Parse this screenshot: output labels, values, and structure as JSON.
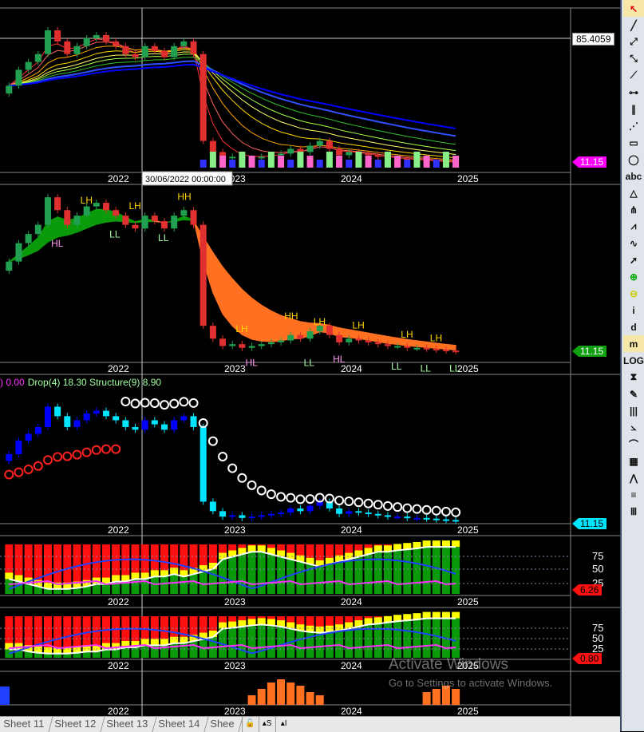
{
  "chart_data": {
    "type": "candlestick",
    "x_ticks": [
      "2022",
      "2023",
      "2024",
      "2025"
    ],
    "closes": [
      60,
      70,
      75,
      80,
      95,
      88,
      80,
      85,
      90,
      92,
      88,
      85,
      80,
      78,
      85,
      82,
      78,
      85,
      88,
      80,
      25,
      18,
      14,
      15,
      13,
      14,
      15,
      16,
      17,
      20,
      18,
      22,
      25,
      20,
      16,
      18,
      17,
      16,
      15,
      14,
      14,
      13,
      13,
      12.5,
      12,
      11.5,
      11.15
    ],
    "oscillator1": [
      30,
      25,
      20,
      15,
      10,
      10,
      10,
      12,
      15,
      20,
      20,
      25,
      25,
      30,
      30,
      35,
      35,
      40,
      35,
      40,
      45,
      50,
      70,
      75,
      80,
      85,
      85,
      80,
      75,
      70,
      65,
      60,
      55,
      60,
      65,
      70,
      75,
      80,
      85,
      85,
      88,
      90,
      92,
      95,
      95,
      95,
      95
    ],
    "oscillator2": [
      20,
      20,
      15,
      12,
      10,
      10,
      10,
      12,
      15,
      15,
      20,
      20,
      25,
      25,
      30,
      30,
      30,
      35,
      35,
      40,
      45,
      50,
      70,
      72,
      75,
      78,
      80,
      78,
      75,
      70,
      65,
      62,
      60,
      62,
      65,
      70,
      75,
      80,
      82,
      85,
      88,
      90,
      92,
      95,
      95,
      95,
      95
    ],
    "volume": [
      0,
      0,
      0,
      0,
      0,
      0,
      0,
      0,
      0,
      0,
      0,
      0,
      0,
      0,
      0,
      0,
      0,
      0,
      0,
      0,
      0,
      0,
      0,
      0,
      0,
      3,
      5,
      7,
      8,
      7,
      6,
      4,
      3,
      0,
      0,
      0,
      0,
      0,
      0,
      0,
      0,
      0,
      0,
      4,
      5,
      6,
      5
    ],
    "swing_labels": [
      {
        "t": "LH",
        "i": -2,
        "p": 88,
        "panel": "upper",
        "c": "#ffd700"
      },
      {
        "t": "HL",
        "i": -5,
        "p": 75,
        "panel": "lower",
        "c": "#ff9cf5"
      },
      {
        "t": "LL",
        "i": 1,
        "p": 80,
        "panel": "lower",
        "c": "#aaffaa"
      },
      {
        "t": "LH",
        "i": 3,
        "p": 85,
        "panel": "upper",
        "c": "#ffd700"
      },
      {
        "t": "LL",
        "i": 6,
        "p": 78,
        "panel": "lower",
        "c": "#aaffaa"
      },
      {
        "t": "HH",
        "i": 8,
        "p": 90,
        "panel": "upper",
        "c": "#ffd700"
      },
      {
        "t": "LH",
        "i": 14,
        "p": 18,
        "panel": "upper",
        "c": "#ffd700"
      },
      {
        "t": "HL",
        "i": 15,
        "p": 10,
        "panel": "lower",
        "c": "#ff9cf5"
      },
      {
        "t": "HH",
        "i": 19,
        "p": 25,
        "panel": "upper",
        "c": "#ffd700"
      },
      {
        "t": "LL",
        "i": 21,
        "p": 10,
        "panel": "lower",
        "c": "#aaffaa"
      },
      {
        "t": "LH",
        "i": 22,
        "p": 22,
        "panel": "upper",
        "c": "#ffd700"
      },
      {
        "t": "HL",
        "i": 24,
        "p": 12,
        "panel": "lower",
        "c": "#ff9cf5"
      },
      {
        "t": "LH",
        "i": 26,
        "p": 20,
        "panel": "upper",
        "c": "#ffd700"
      },
      {
        "t": "LL",
        "i": 30,
        "p": 8,
        "panel": "lower",
        "c": "#aaffaa"
      },
      {
        "t": "LH",
        "i": 31,
        "p": 15,
        "panel": "upper",
        "c": "#ffd700"
      },
      {
        "t": "LL",
        "i": 33,
        "p": 7,
        "panel": "lower",
        "c": "#aaffaa"
      },
      {
        "t": "LH",
        "i": 34,
        "p": 13,
        "panel": "upper",
        "c": "#ffd700"
      },
      {
        "t": "LL",
        "i": 36,
        "p": 7,
        "panel": "lower",
        "c": "#aaffaa"
      }
    ]
  },
  "legend": {
    "part1": ") 0.00",
    "part2": "Drop(4) 18.30 Structure(9) 8.90"
  },
  "cursor_date": "30/06/2022 00:00:00",
  "price_tags": {
    "crosshair": "85.4059",
    "p1": "11.15",
    "p2": "11.15",
    "p3": "11.15",
    "p4": "6.26",
    "p5": "0.80"
  },
  "osc_levels": [
    "75",
    "50",
    "25"
  ],
  "tabs": [
    "Sheet 11",
    "Sheet 12",
    "Sheet 13",
    "Sheet 14",
    "Shee"
  ],
  "tab_buttons": [
    "🔓",
    "▴S",
    "▴I"
  ],
  "watermark": {
    "title": "Activate Windows",
    "subtitle": "Go to Settings to activate Windows."
  },
  "tools": [
    "cursor",
    "line",
    "ray",
    "extended-line",
    "segment",
    "h-line",
    "parallel",
    "fan",
    "rectangle",
    "ellipse",
    "abc",
    "triangle",
    "pitchfork",
    "zigzag",
    "wave",
    "arrow",
    "zoom-in",
    "zoom-out",
    "i",
    "d",
    "m",
    "LOG",
    "hourglass",
    "pen",
    "vlines",
    "gann",
    "arc",
    "grid",
    "speed-fan",
    "fib",
    "cycle"
  ]
}
